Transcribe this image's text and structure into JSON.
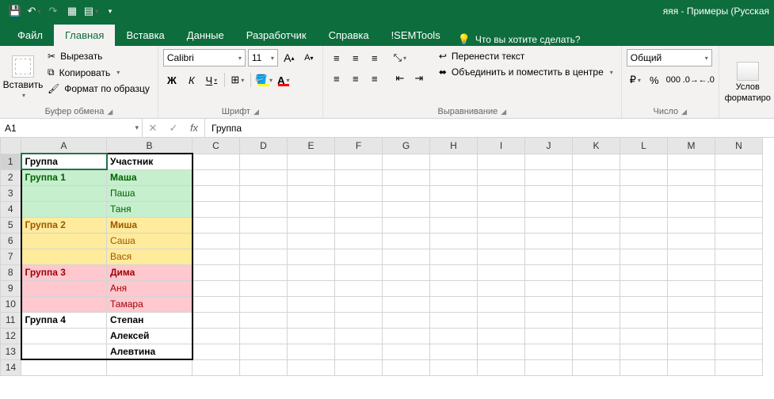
{
  "titlebar": {
    "title": "яяя - Примеры (Русская",
    "qat": [
      "save-icon",
      "undo-icon",
      "redo-icon",
      "touch-mode-icon",
      "customize-icon"
    ]
  },
  "tabs": {
    "items": [
      "Файл",
      "Главная",
      "Вставка",
      "Данные",
      "Разработчик",
      "Справка",
      "!SEMTools"
    ],
    "active_index": 1,
    "tellme": "Что вы хотите сделать?"
  },
  "ribbon": {
    "clipboard": {
      "paste": "Вставить",
      "cut": "Вырезать",
      "copy": "Копировать",
      "format_painter": "Формат по образцу",
      "label": "Буфер обмена"
    },
    "font": {
      "name": "Calibri",
      "size": "11",
      "increase": "A",
      "decrease": "A",
      "bold": "Ж",
      "italic": "К",
      "underline": "Ч",
      "border": "⊞",
      "fill": "A",
      "color": "A",
      "label": "Шрифт"
    },
    "alignment": {
      "wrap": "Перенести текст",
      "merge": "Объединить и поместить в центре",
      "label": "Выравнивание"
    },
    "number": {
      "format": "Общий",
      "label": "Число"
    },
    "styles": {
      "conditional": "Услов",
      "conditional2": "форматиро",
      "label": ""
    }
  },
  "formula_bar": {
    "namebox": "A1",
    "formula": "Группа"
  },
  "grid": {
    "columns": [
      "A",
      "B",
      "C",
      "D",
      "E",
      "F",
      "G",
      "H",
      "I",
      "J",
      "K",
      "L",
      "M",
      "N"
    ],
    "rows": [
      {
        "n": 1,
        "a": "Группа",
        "b": "Участник",
        "style": "header"
      },
      {
        "n": 2,
        "a": "Группа 1",
        "b": "Маша",
        "style": "green",
        "head": true
      },
      {
        "n": 3,
        "a": "",
        "b": "Паша",
        "style": "green"
      },
      {
        "n": 4,
        "a": "",
        "b": "Таня",
        "style": "green"
      },
      {
        "n": 5,
        "a": "Группа 2",
        "b": "Миша",
        "style": "yellow",
        "head": true
      },
      {
        "n": 6,
        "a": "",
        "b": "Саша",
        "style": "yellow"
      },
      {
        "n": 7,
        "a": "",
        "b": "Вася",
        "style": "yellow"
      },
      {
        "n": 8,
        "a": "Группа 3",
        "b": "Дима",
        "style": "pink",
        "head": true
      },
      {
        "n": 9,
        "a": "",
        "b": "Аня",
        "style": "pink"
      },
      {
        "n": 10,
        "a": "",
        "b": "Тамара",
        "style": "pink"
      },
      {
        "n": 11,
        "a": "Группа 4",
        "b": "Степан",
        "style": "plain",
        "head": true
      },
      {
        "n": 12,
        "a": "",
        "b": "Алексей",
        "style": "plain"
      },
      {
        "n": 13,
        "a": "",
        "b": "Алевтина",
        "style": "plain"
      },
      {
        "n": 14,
        "a": "",
        "b": "",
        "style": "empty"
      }
    ]
  }
}
